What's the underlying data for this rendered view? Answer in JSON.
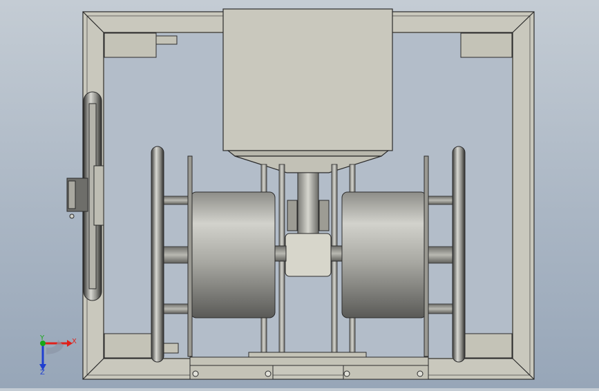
{
  "viewport": {
    "background_top": "#c4ccd4",
    "background_bottom": "#97a6b8",
    "part_color": "#c9c8bd",
    "edge_color": "#2b2b2b"
  },
  "orientation_triad": {
    "x_label": "X",
    "y_label": "Y",
    "z_label": "Z",
    "x_color": "#e0201a",
    "y_color": "#18a818",
    "z_color": "#1f3fd0"
  }
}
